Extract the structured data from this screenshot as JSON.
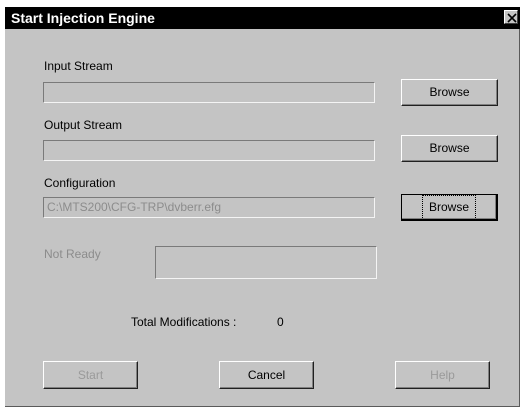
{
  "dialog": {
    "title": "Start Injection Engine",
    "close_icon": "close-icon"
  },
  "input_stream": {
    "label": "Input Stream",
    "value": "",
    "browse_label": "Browse"
  },
  "output_stream": {
    "label": "Output Stream",
    "value": "",
    "browse_label": "Browse"
  },
  "configuration": {
    "label": "Configuration",
    "value": "C:\\MTS200\\CFG-TRP\\dvberr.efg",
    "browse_label": "Browse"
  },
  "status": {
    "label": "Not Ready",
    "value": ""
  },
  "modifications": {
    "label": "Total Modifications :",
    "count": "0"
  },
  "buttons": {
    "start": "Start",
    "cancel": "Cancel",
    "help": "Help"
  },
  "colors": {
    "dialog_bg": "#c4c4c4",
    "titlebar_bg": "#000000",
    "disabled_text": "#8c8c8c"
  }
}
